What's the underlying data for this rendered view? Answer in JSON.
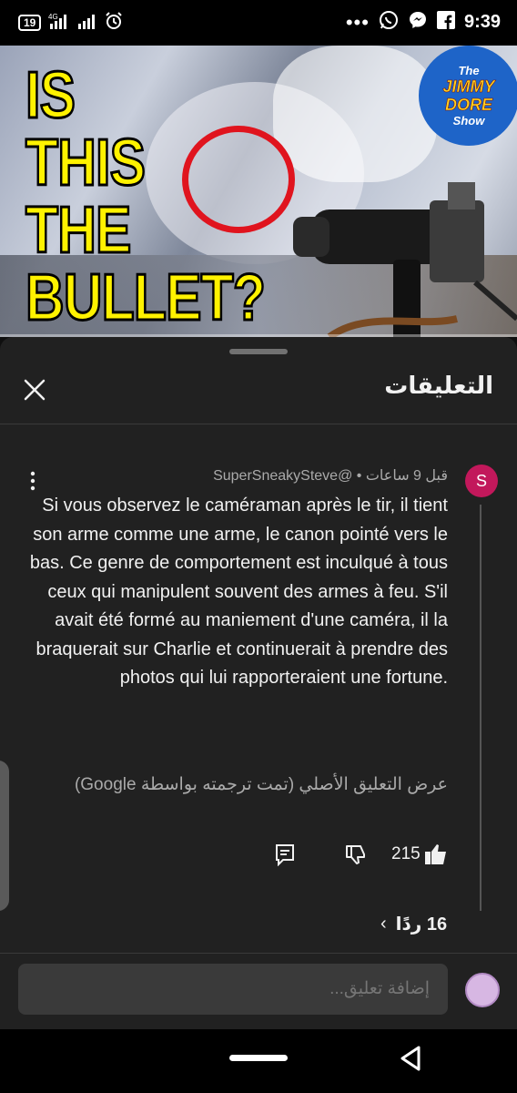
{
  "status_bar": {
    "notification_count": "19",
    "network": "4G",
    "time": "9:39",
    "left_icons": [
      "sim-badge",
      "signal-4g-icon",
      "signal-icon",
      "alarm-icon"
    ],
    "right_icons": [
      "more-dots",
      "whatsapp-icon",
      "messenger-icon",
      "facebook-icon"
    ]
  },
  "video": {
    "overlay_text_lines": [
      "IS",
      "THIS",
      "THE",
      "BULLET?"
    ],
    "logo_lines": [
      "The",
      "JIMMY",
      "DORE",
      "Show"
    ],
    "highlight_color": "#e0141e",
    "text_color": "#fff200"
  },
  "comments_sheet": {
    "title": "التعليقات",
    "close_icon": "close-icon"
  },
  "comment": {
    "avatar_letter": "S",
    "avatar_color": "#c2185b",
    "author": "@SuperSneakySteve",
    "time_ago": "قبل 9 ساعات",
    "separator": "•",
    "text": "Si vous observez le caméraman après le tir, il tient son arme comme une arme, le canon pointé vers le bas. Ce genre de comportement est inculqué à tous ceux qui manipulent souvent des armes à feu. S'il avait été formé au maniement d'une caméra, il la braquerait sur Charlie et continuerait à prendre des photos qui lui rapporteraient une fortune.",
    "translation_link": "عرض التعليق الأصلي (تمت ترجمته بواسطة Google)",
    "like_count": "215",
    "replies_label": "16 ردًا"
  },
  "composer": {
    "placeholder": "إضافة تعليق..."
  }
}
